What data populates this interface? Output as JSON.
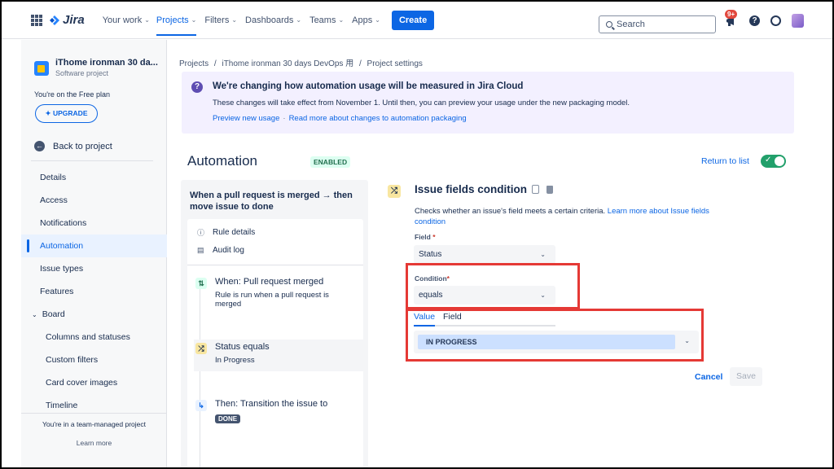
{
  "topnav": {
    "logo": "Jira",
    "items": [
      {
        "label": "Your work"
      },
      {
        "label": "Projects"
      },
      {
        "label": "Filters"
      },
      {
        "label": "Dashboards"
      },
      {
        "label": "Teams"
      },
      {
        "label": "Apps"
      }
    ],
    "create_label": "Create",
    "search_placeholder": "Search",
    "notification_badge": "9+",
    "colors": {
      "primary": "#0c66e4",
      "badge": "#e2483d"
    }
  },
  "sidebar": {
    "project_name": "iThome ironman 30 da...",
    "project_type": "Software project",
    "plan_text": "You're on the Free plan",
    "upgrade_label": "UPGRADE",
    "back_label": "Back to project",
    "items": [
      {
        "label": "Details"
      },
      {
        "label": "Access"
      },
      {
        "label": "Notifications"
      },
      {
        "label": "Automation"
      },
      {
        "label": "Issue types"
      },
      {
        "label": "Features"
      },
      {
        "label": "Board"
      },
      {
        "label": "Columns and statuses"
      },
      {
        "label": "Custom filters"
      },
      {
        "label": "Card cover images"
      },
      {
        "label": "Timeline"
      }
    ],
    "footer_text": "You're in a team-managed project",
    "learn_more": "Learn more"
  },
  "breadcrumb": {
    "items": [
      "Projects",
      "iThome ironman 30 days DevOps 用",
      "Project settings"
    ],
    "separator": "/"
  },
  "banner": {
    "title": "We're changing how automation usage will be measured in Jira Cloud",
    "text": "These changes will take effect from November 1. Until then, you can preview your usage under the new packaging model.",
    "link1": "Preview new usage",
    "link2": "Read more about changes to automation packaging",
    "color": "#f3f0ff"
  },
  "automation": {
    "title": "Automation",
    "status": "ENABLED",
    "return_label": "Return to list",
    "toggle_on": true
  },
  "rule": {
    "name": "When a pull request is merged → then move issue to done",
    "details_label": "Rule details",
    "audit_label": "Audit log",
    "trigger_title": "When: Pull request merged",
    "trigger_desc": "Rule is run when a pull request is merged",
    "condition_title": "Status equals",
    "condition_desc": "In Progress",
    "action_title": "Then: Transition the issue to",
    "action_badge": "DONE"
  },
  "condition_form": {
    "title": "Issue fields condition",
    "desc": "Checks whether an issue's field meets a certain criteria. ",
    "desc_link": "Learn more about Issue fields condition",
    "field_label": "Field",
    "field_value": "Status",
    "condition_label": "Condition",
    "condition_value": "equals",
    "required_mark": "*",
    "tab_value": "Value",
    "tab_field": "Field",
    "value_selected": "IN PROGRESS",
    "cancel_label": "Cancel",
    "save_label": "Save",
    "highlight_color": "#e53935"
  }
}
